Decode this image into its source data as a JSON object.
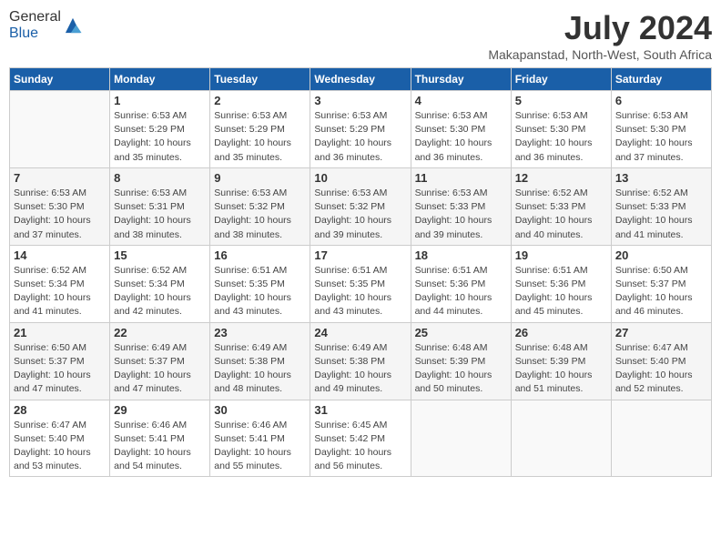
{
  "header": {
    "logo_general": "General",
    "logo_blue": "Blue",
    "month_title": "July 2024",
    "location": "Makapanstad, North-West, South Africa"
  },
  "weekdays": [
    "Sunday",
    "Monday",
    "Tuesday",
    "Wednesday",
    "Thursday",
    "Friday",
    "Saturday"
  ],
  "weeks": [
    [
      {
        "day": "",
        "text": ""
      },
      {
        "day": "1",
        "text": "Sunrise: 6:53 AM\nSunset: 5:29 PM\nDaylight: 10 hours\nand 35 minutes."
      },
      {
        "day": "2",
        "text": "Sunrise: 6:53 AM\nSunset: 5:29 PM\nDaylight: 10 hours\nand 35 minutes."
      },
      {
        "day": "3",
        "text": "Sunrise: 6:53 AM\nSunset: 5:29 PM\nDaylight: 10 hours\nand 36 minutes."
      },
      {
        "day": "4",
        "text": "Sunrise: 6:53 AM\nSunset: 5:30 PM\nDaylight: 10 hours\nand 36 minutes."
      },
      {
        "day": "5",
        "text": "Sunrise: 6:53 AM\nSunset: 5:30 PM\nDaylight: 10 hours\nand 36 minutes."
      },
      {
        "day": "6",
        "text": "Sunrise: 6:53 AM\nSunset: 5:30 PM\nDaylight: 10 hours\nand 37 minutes."
      }
    ],
    [
      {
        "day": "7",
        "text": "Sunrise: 6:53 AM\nSunset: 5:30 PM\nDaylight: 10 hours\nand 37 minutes."
      },
      {
        "day": "8",
        "text": "Sunrise: 6:53 AM\nSunset: 5:31 PM\nDaylight: 10 hours\nand 38 minutes."
      },
      {
        "day": "9",
        "text": "Sunrise: 6:53 AM\nSunset: 5:32 PM\nDaylight: 10 hours\nand 38 minutes."
      },
      {
        "day": "10",
        "text": "Sunrise: 6:53 AM\nSunset: 5:32 PM\nDaylight: 10 hours\nand 39 minutes."
      },
      {
        "day": "11",
        "text": "Sunrise: 6:53 AM\nSunset: 5:33 PM\nDaylight: 10 hours\nand 39 minutes."
      },
      {
        "day": "12",
        "text": "Sunrise: 6:52 AM\nSunset: 5:33 PM\nDaylight: 10 hours\nand 40 minutes."
      },
      {
        "day": "13",
        "text": "Sunrise: 6:52 AM\nSunset: 5:33 PM\nDaylight: 10 hours\nand 41 minutes."
      }
    ],
    [
      {
        "day": "14",
        "text": "Sunrise: 6:52 AM\nSunset: 5:34 PM\nDaylight: 10 hours\nand 41 minutes."
      },
      {
        "day": "15",
        "text": "Sunrise: 6:52 AM\nSunset: 5:34 PM\nDaylight: 10 hours\nand 42 minutes."
      },
      {
        "day": "16",
        "text": "Sunrise: 6:51 AM\nSunset: 5:35 PM\nDaylight: 10 hours\nand 43 minutes."
      },
      {
        "day": "17",
        "text": "Sunrise: 6:51 AM\nSunset: 5:35 PM\nDaylight: 10 hours\nand 43 minutes."
      },
      {
        "day": "18",
        "text": "Sunrise: 6:51 AM\nSunset: 5:36 PM\nDaylight: 10 hours\nand 44 minutes."
      },
      {
        "day": "19",
        "text": "Sunrise: 6:51 AM\nSunset: 5:36 PM\nDaylight: 10 hours\nand 45 minutes."
      },
      {
        "day": "20",
        "text": "Sunrise: 6:50 AM\nSunset: 5:37 PM\nDaylight: 10 hours\nand 46 minutes."
      }
    ],
    [
      {
        "day": "21",
        "text": "Sunrise: 6:50 AM\nSunset: 5:37 PM\nDaylight: 10 hours\nand 47 minutes."
      },
      {
        "day": "22",
        "text": "Sunrise: 6:49 AM\nSunset: 5:37 PM\nDaylight: 10 hours\nand 47 minutes."
      },
      {
        "day": "23",
        "text": "Sunrise: 6:49 AM\nSunset: 5:38 PM\nDaylight: 10 hours\nand 48 minutes."
      },
      {
        "day": "24",
        "text": "Sunrise: 6:49 AM\nSunset: 5:38 PM\nDaylight: 10 hours\nand 49 minutes."
      },
      {
        "day": "25",
        "text": "Sunrise: 6:48 AM\nSunset: 5:39 PM\nDaylight: 10 hours\nand 50 minutes."
      },
      {
        "day": "26",
        "text": "Sunrise: 6:48 AM\nSunset: 5:39 PM\nDaylight: 10 hours\nand 51 minutes."
      },
      {
        "day": "27",
        "text": "Sunrise: 6:47 AM\nSunset: 5:40 PM\nDaylight: 10 hours\nand 52 minutes."
      }
    ],
    [
      {
        "day": "28",
        "text": "Sunrise: 6:47 AM\nSunset: 5:40 PM\nDaylight: 10 hours\nand 53 minutes."
      },
      {
        "day": "29",
        "text": "Sunrise: 6:46 AM\nSunset: 5:41 PM\nDaylight: 10 hours\nand 54 minutes."
      },
      {
        "day": "30",
        "text": "Sunrise: 6:46 AM\nSunset: 5:41 PM\nDaylight: 10 hours\nand 55 minutes."
      },
      {
        "day": "31",
        "text": "Sunrise: 6:45 AM\nSunset: 5:42 PM\nDaylight: 10 hours\nand 56 minutes."
      },
      {
        "day": "",
        "text": ""
      },
      {
        "day": "",
        "text": ""
      },
      {
        "day": "",
        "text": ""
      }
    ]
  ]
}
